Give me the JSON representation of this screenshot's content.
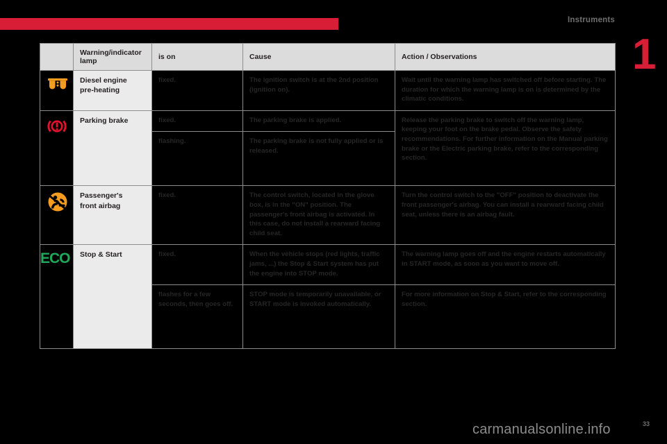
{
  "header": {
    "chapter_title": "Instruments",
    "chapter_number": "1",
    "bar_color": "#d81e36"
  },
  "table": {
    "columns": [
      {
        "key": "lamp",
        "label": "Warning/indicator lamp"
      },
      {
        "key": "is_on",
        "label": "is on"
      },
      {
        "key": "cause",
        "label": "Cause"
      },
      {
        "key": "action",
        "label": "Action / Observations"
      }
    ],
    "rows": [
      {
        "icon": "glow-plug-icon",
        "icon_color": "#f59c1e",
        "name": "Diesel engine\npre-heating",
        "name_line1": "Diesel engine",
        "name_line2": "pre-heating",
        "states": [
          {
            "is_on": "fixed.",
            "cause": "The ignition switch is at the 2nd position (ignition on).",
            "action": "Wait until the warning lamp has switched off before starting. The duration for which the warning lamp is on is determined by the climatic conditions."
          }
        ]
      },
      {
        "icon": "parking-brake-icon",
        "icon_color": "#e8112d",
        "name_line1": "Parking brake",
        "name_line2": "",
        "states": [
          {
            "is_on": "fixed.",
            "cause": "The parking brake is applied.",
            "action": "Release the parking brake to switch off the warning lamp, keeping your foot on the brake pedal. Observe the safety recommendations. For further information on the Manual parking brake or the Electric parking brake, refer to the corresponding section."
          },
          {
            "is_on": "flashing.",
            "cause": "The parking brake is not fully applied or is released.",
            "action": ""
          }
        ]
      },
      {
        "icon": "passenger-airbag-icon",
        "icon_color": "#f59c1e",
        "name_line1": "Passenger's",
        "name_line2": "front airbag",
        "states": [
          {
            "is_on": "fixed.",
            "cause": "The control switch, located in the glove box, is in the \"ON\" position. The passenger's front airbag is activated. In this case, do not install a rearward facing child seat.",
            "action": "Turn the control switch to the \"OFF\" position to deactivate the front passenger's airbag. You can install a rearward facing child seat, unless there is an airbag fault."
          }
        ]
      },
      {
        "icon": "eco-icon",
        "icon_color": "#1fa95a",
        "icon_text": "ECO",
        "name_line1": "Stop & Start",
        "name_line2": "",
        "states": [
          {
            "is_on": "fixed.",
            "cause": "When the vehicle stops (red lights, traffic jams, ...) the Stop & Start system has put the engine into STOP mode.",
            "action": "The warning lamp goes off and the engine restarts automatically in START mode, as soon as you want to move off."
          },
          {
            "is_on": "flashes for a few seconds, then goes off.",
            "cause": "STOP mode is temporarily unavailable, or START mode is invoked automatically.",
            "action": "For more information on Stop & Start, refer to the corresponding section."
          }
        ]
      }
    ]
  },
  "footer": {
    "watermark": "carmanualsonline.info",
    "page_number": "33"
  }
}
